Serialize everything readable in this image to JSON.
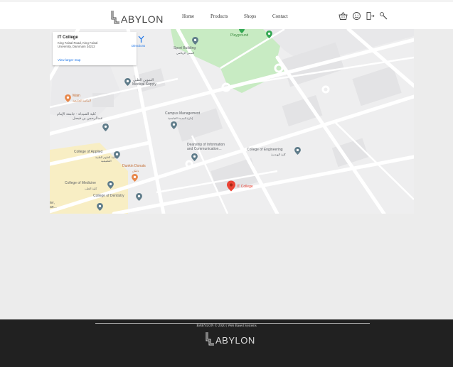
{
  "header": {
    "logo_text": "ABYLON",
    "nav": [
      "Home",
      "Products",
      "Shops",
      "Contact"
    ],
    "icons": [
      "basket-icon",
      "smiley-icon",
      "sign-in-icon",
      "wrench-icon"
    ]
  },
  "map": {
    "info": {
      "title": "IT College",
      "address_line1": "King Faisal Road, King Faisal",
      "address_line2": "University, Dammam 34212",
      "view_larger": "View larger map",
      "directions": "Directions"
    },
    "labels": {
      "playground": "Playground",
      "sport_building": "Sport Building",
      "sport_building_ar": "المبنى الرياضي",
      "medical_supply_ar": "التموين الطبي",
      "medical_supply": "Medical Supply",
      "main": "Main",
      "main_ar": "المكتبة الجامعية",
      "imam_ar_1": "كلية الصيدلة - جامعة الإمام",
      "imam_ar_2": "عبدالرحمن بن فيصل",
      "campus_management": "Campus Management",
      "campus_management_ar": "إدارة المدينة الجامعية",
      "deanship_1": "Deanship of Information",
      "deanship_2": "and Communication...",
      "college_engineering": "College of Engineering",
      "college_engineering_ar": "كلية الهندسة",
      "college_applied": "College of Applied",
      "college_applied_ar_1": "كلية العلوم الطبية",
      "college_applied_ar_2": "التطبيقية",
      "dunkin": "Dunkin Donuts",
      "dunkin_ar": "دانكن",
      "it_college": "IT College",
      "college_medicine": "College of Medicine",
      "college_medicine_ar": "كلية الطب",
      "college_dentistry": "College of Dentistry",
      "edge_1": "ter,",
      "edge_2": "an..."
    },
    "colors": {
      "pin": "#ea4335",
      "park": "#c8ebc3",
      "road": "#ffffff",
      "pin_gray": "#5f7c8a",
      "pin_orange": "#e8874a"
    }
  },
  "footer": {
    "copyright": "BABYLON © 2020 | Web Based Systems",
    "logo_text": "ABYLON"
  }
}
